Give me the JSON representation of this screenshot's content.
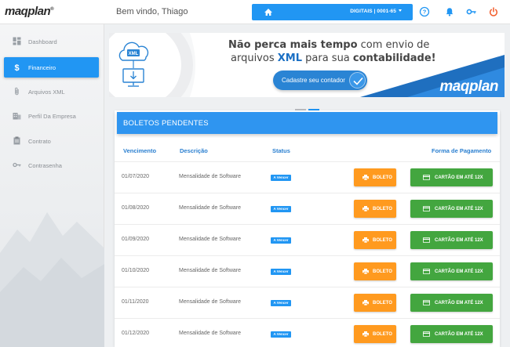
{
  "header": {
    "logo": "maqplan",
    "logo_mark": "®",
    "welcome": "Bem vindo, Thiago",
    "company": "DIGITAIS | 0001-65",
    "icons": [
      "home-icon",
      "help-icon",
      "bell-icon",
      "key-icon",
      "power-icon"
    ],
    "accent_color": "#2196f3"
  },
  "sidebar": {
    "items": [
      {
        "label": "Dashboard",
        "icon": "dashboard-icon"
      },
      {
        "label": "Financeiro",
        "icon": "dollar-icon"
      },
      {
        "label": "Arquivos XML",
        "icon": "paperclip-icon"
      },
      {
        "label": "Perfil Da Empresa",
        "icon": "building-icon"
      },
      {
        "label": "Contrato",
        "icon": "clipboard-icon"
      },
      {
        "label": "Contrasenha",
        "icon": "key-icon"
      }
    ],
    "active_index": 1
  },
  "banner": {
    "line1_bold": "Não perca mais tempo",
    "line1_rest": " com envio de",
    "line2_start": "arquivos ",
    "line2_xml": "XML",
    "line2_mid": " para sua ",
    "line2_bold": "contabilidade!",
    "cta": "Cadastre seu contador",
    "icon_label": "XML",
    "logo": "maqplan"
  },
  "card": {
    "title": "BOLETOS PENDENTES",
    "columns": [
      "Vencimento",
      "Descrição",
      "Status",
      "Forma de Pagamento"
    ],
    "boleto_label": "BOLETO",
    "cartao_label": "CARTÃO EM ATÉ 12X",
    "rows": [
      {
        "vencimento": "01/07/2020",
        "descricao": "Mensalidade de Software",
        "status": "A Vencer"
      },
      {
        "vencimento": "01/08/2020",
        "descricao": "Mensalidade de Software",
        "status": "A Vencer"
      },
      {
        "vencimento": "01/09/2020",
        "descricao": "Mensalidade de Software",
        "status": "A Vencer"
      },
      {
        "vencimento": "01/10/2020",
        "descricao": "Mensalidade de Software",
        "status": "A Vencer"
      },
      {
        "vencimento": "01/11/2020",
        "descricao": "Mensalidade de Software",
        "status": "A Vencer"
      },
      {
        "vencimento": "01/12/2020",
        "descricao": "Mensalidade de Software",
        "status": "A Vencer"
      }
    ],
    "colors": {
      "boleto": "#ff9a1f",
      "cartao": "#43a63f",
      "status": "#2196f3"
    }
  }
}
